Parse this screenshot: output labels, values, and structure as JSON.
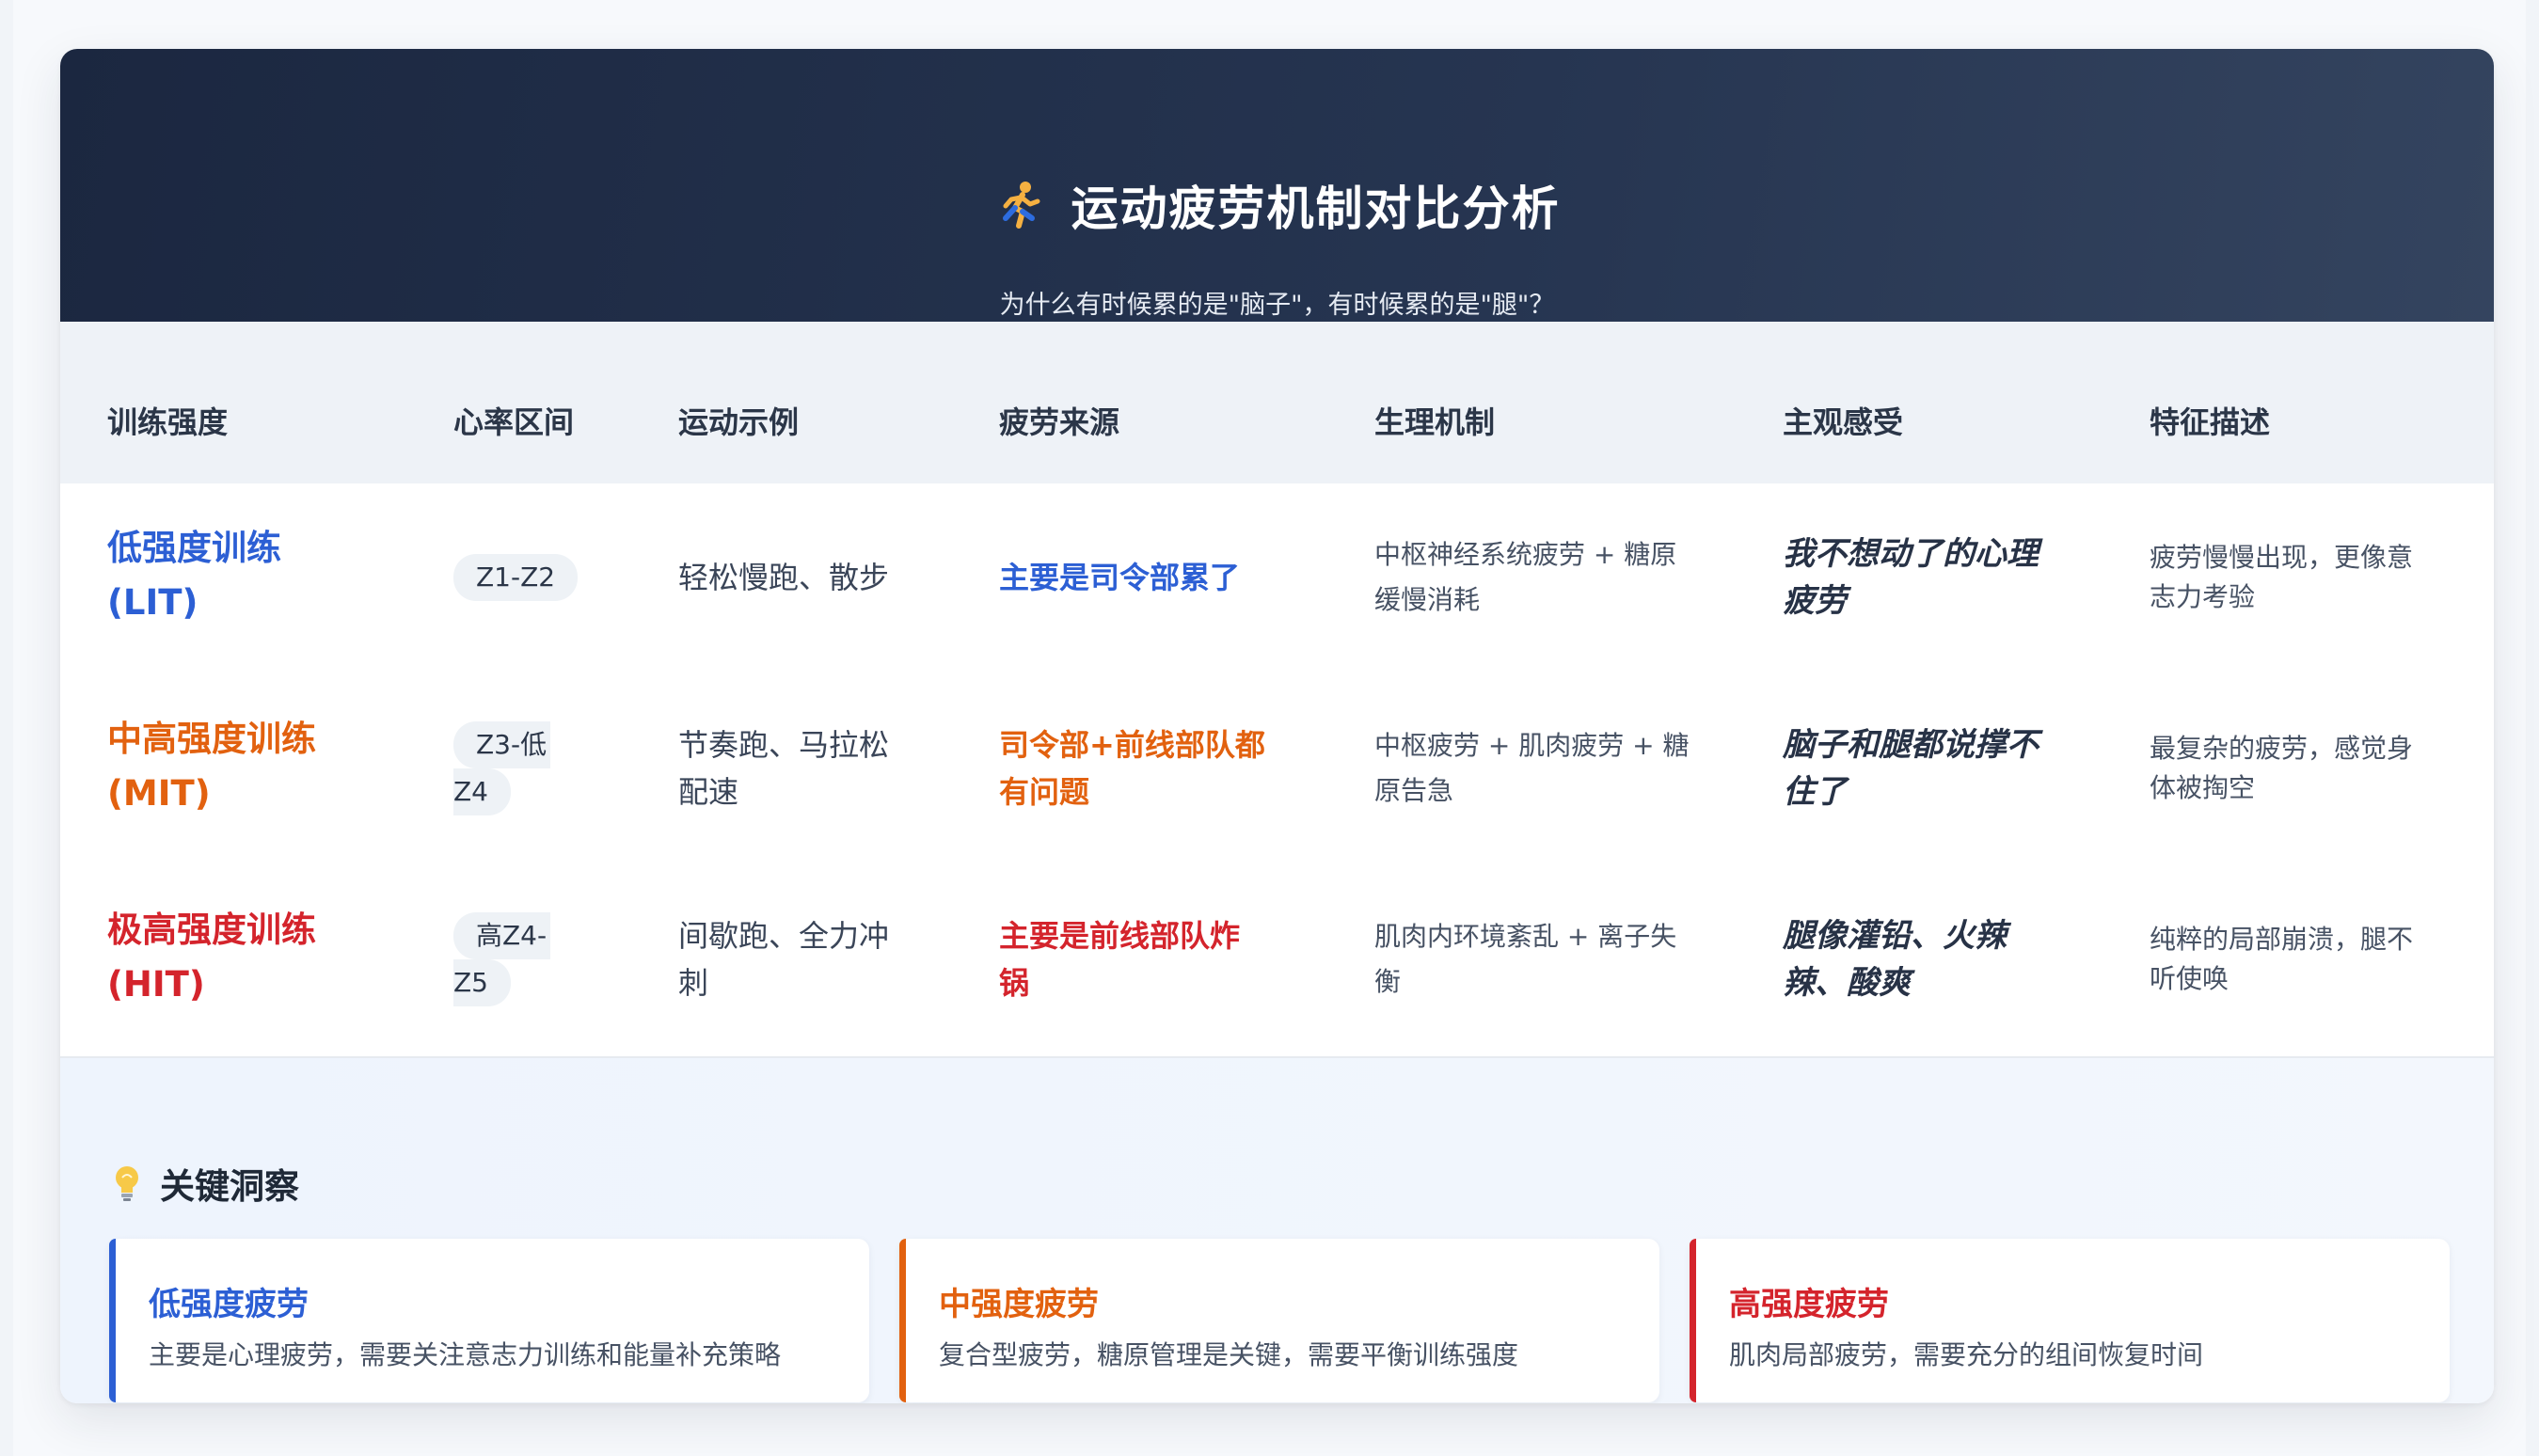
{
  "header": {
    "title": "运动疲劳机制对比分析",
    "subtitle": "为什么有时候累的是\"脑子\"，有时候累的是\"腿\"？",
    "title_icon": "runner-icon"
  },
  "table": {
    "columns": [
      "训练强度",
      "心率区间",
      "运动示例",
      "疲劳来源",
      "生理机制",
      "主观感受",
      "特征描述"
    ],
    "rows": [
      {
        "intensity": [
          "低强度训练",
          "(LIT)"
        ],
        "zone": [
          "Z1-Z2"
        ],
        "example": [
          "轻松慢跑、散步"
        ],
        "source": [
          "主要是司令部累了"
        ],
        "mechanism": [
          "中枢神经系统疲劳 + 糖原",
          "缓慢消耗"
        ],
        "feeling": [
          "我不想动了的心理",
          "疲劳"
        ],
        "description": [
          "疲劳慢慢出现，更像意",
          "志力考验"
        ],
        "accent": "#2c5fd4"
      },
      {
        "intensity": [
          "中高强度训练",
          "(MIT)"
        ],
        "zone": [
          "Z3-低",
          "Z4"
        ],
        "example": [
          "节奏跑、马拉松",
          "配速"
        ],
        "source": [
          "司令部+前线部队都",
          "有问题"
        ],
        "mechanism": [
          "中枢疲劳 + 肌肉疲劳 + 糖",
          "原告急"
        ],
        "feeling": [
          "脑子和腿都说撑不",
          "住了"
        ],
        "description": [
          "最复杂的疲劳，感觉身",
          "体被掏空"
        ],
        "accent": "#e2610f"
      },
      {
        "intensity": [
          "极高强度训练",
          "(HIT)"
        ],
        "zone": [
          "高Z4-",
          "Z5"
        ],
        "example": [
          "间歇跑、全力冲",
          "刺"
        ],
        "source": [
          "主要是前线部队炸",
          "锅"
        ],
        "mechanism": [
          "肌肉内环境紊乱 + 离子失",
          "衡"
        ],
        "feeling": [
          "腿像灌铅、火辣",
          "辣、酸爽"
        ],
        "description": [
          "纯粹的局部崩溃，腿不",
          "听使唤"
        ],
        "accent": "#d4242c"
      }
    ]
  },
  "insights": {
    "title": "关键洞察",
    "title_icon": "lightbulb-icon",
    "cards": [
      {
        "title": "低强度疲劳",
        "text": "主要是心理疲劳，需要关注意志力训练和能量补充策略",
        "accent": "#2c5fd4"
      },
      {
        "title": "中强度疲劳",
        "text": "复合型疲劳，糖原管理是关键，需要平衡训练强度",
        "accent": "#e2610f"
      },
      {
        "title": "高强度疲劳",
        "text": "肌肉局部疲劳，需要充分的组间恢复时间",
        "accent": "#d4242c"
      }
    ]
  }
}
